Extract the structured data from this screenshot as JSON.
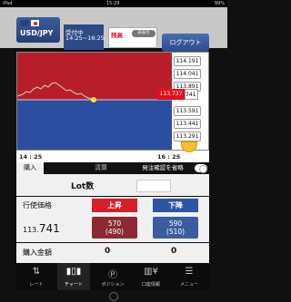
{
  "status": {
    "left": "iPad",
    "time": "15:29",
    "right": "99%"
  },
  "header": {
    "pair": "USD/JPY",
    "hours_label": "受付中",
    "hours": "14:25~16:25",
    "zandaka_label": "残高",
    "zandaka_toggle": "非表示",
    "logout": "ログアウト"
  },
  "chart": {
    "axis_ticks": [
      "114.191",
      "114.041",
      "113.891",
      "113.591",
      "113.441",
      "113.291"
    ],
    "current_price_red": "113.737",
    "current_price_tail": "741",
    "time_start": "14 : 25",
    "time_end": "16 : 25"
  },
  "tabs": {
    "buy": "購入",
    "settle": "清算",
    "confirm": "発注確認を省略"
  },
  "order": {
    "lot_label": "Lot数",
    "price_label": "行使価格",
    "up_label": "上昇",
    "down_label": "下降",
    "strike_prefix": "113.",
    "strike_suffix": "741",
    "up_price": "570",
    "up_sub": "(490)",
    "down_price": "590",
    "down_sub": "(510)",
    "amount_label": "購入金額",
    "amount_up": "0",
    "amount_down": "0"
  },
  "footer": {
    "items": [
      {
        "label": "レート",
        "icon": "arrows-icon"
      },
      {
        "label": "チャート",
        "icon": "candlestick-icon"
      },
      {
        "label": "ポジション",
        "icon": "p-circle-icon"
      },
      {
        "label": "口座情報",
        "icon": "bar-chart-icon"
      },
      {
        "label": "メニュー",
        "icon": "menu-icon"
      }
    ]
  },
  "colors": {
    "accent": "#2d4a86",
    "up": "#d51f2b",
    "down": "#2b55a5"
  }
}
